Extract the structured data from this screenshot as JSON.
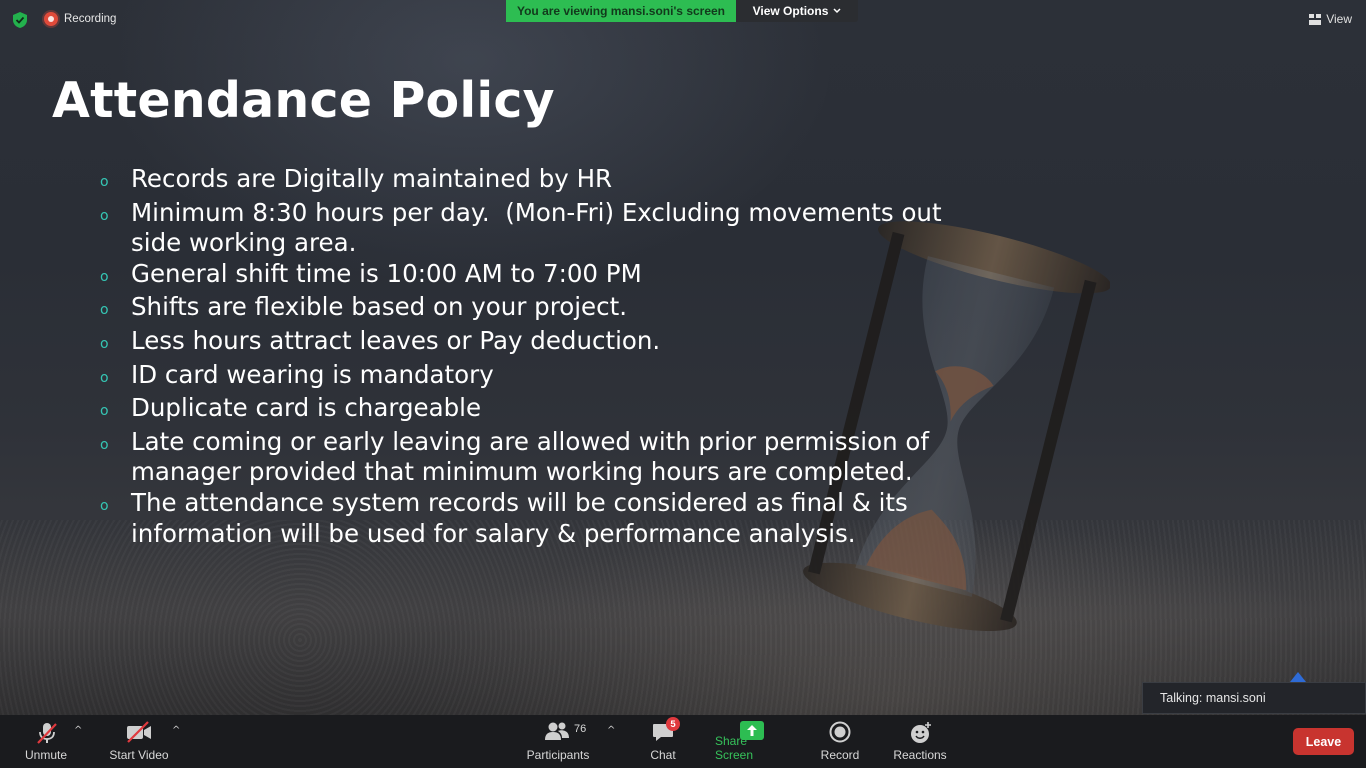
{
  "topbar": {
    "recording_label": "Recording",
    "viewing_banner": "You are viewing mansi.soni's screen",
    "view_options_label": "View Options",
    "view_label": "View"
  },
  "slide": {
    "title": "Attendance Policy",
    "bullets": [
      "Records are Digitally maintained by HR",
      "Minimum 8:30 hours per day.  (Mon-Fri) Excluding movements out\nside working area.",
      "General shift time is 10:00 AM to 7:00 PM",
      "Shifts are flexible based on your project.",
      "Less hours attract leaves or Pay deduction.",
      "ID card wearing is mandatory",
      "Duplicate card is chargeable",
      "Late coming or early leaving are allowed with prior permission of\nmanager provided that minimum working hours are completed.",
      "The attendance system records will be considered as final & its\ninformation will be used for salary & performance analysis."
    ],
    "bullet_glyph": "o"
  },
  "talking": {
    "text": "Talking: mansi.soni"
  },
  "toolbar": {
    "unmute_label": "Unmute",
    "start_video_label": "Start Video",
    "participants_label": "Participants",
    "participants_count": "76",
    "chat_label": "Chat",
    "chat_badge": "5",
    "share_label": "Share Screen",
    "record_label": "Record",
    "reactions_label": "Reactions",
    "leave_label": "Leave"
  },
  "colors": {
    "accent_green": "#2dbd52",
    "leave_red": "#c8342f",
    "bullet_teal": "#35c6b4",
    "badge_red": "#e0393e"
  },
  "icons": [
    "shield-check-icon",
    "recording-icon",
    "chevron-down-icon",
    "view-grid-icon",
    "muted-mic-icon",
    "video-off-icon",
    "participants-icon",
    "chat-icon",
    "share-screen-icon",
    "record-icon",
    "reactions-icon"
  ]
}
